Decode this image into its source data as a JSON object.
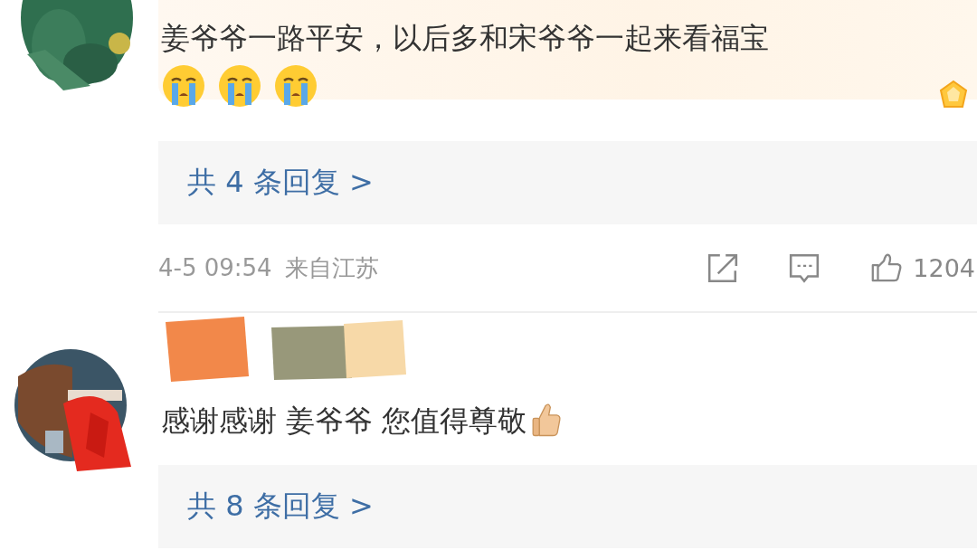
{
  "comments": [
    {
      "avatar": {
        "kind": "picture"
      },
      "author": {
        "redacted": false
      },
      "highlighted": true,
      "text": "姜爷爷一路平安，以后多和宋爷爷一起来看福宝",
      "emojis": [
        {
          "kind": "crying"
        },
        {
          "kind": "crying"
        },
        {
          "kind": "crying"
        }
      ],
      "replies": "共 4 条回复 >",
      "meta": {
        "time": "4-5 09:54",
        "location": "来自江苏",
        "likes": "1204"
      }
    },
    {
      "avatar": {
        "kind": "picture"
      },
      "author": {
        "redacted": true
      },
      "highlighted": false,
      "text": "感谢感谢 姜爷爷 您值得尊敬",
      "emojis": [
        {
          "kind": "thumbs-up"
        }
      ],
      "replies": "共 8 条回复 >"
    }
  ]
}
